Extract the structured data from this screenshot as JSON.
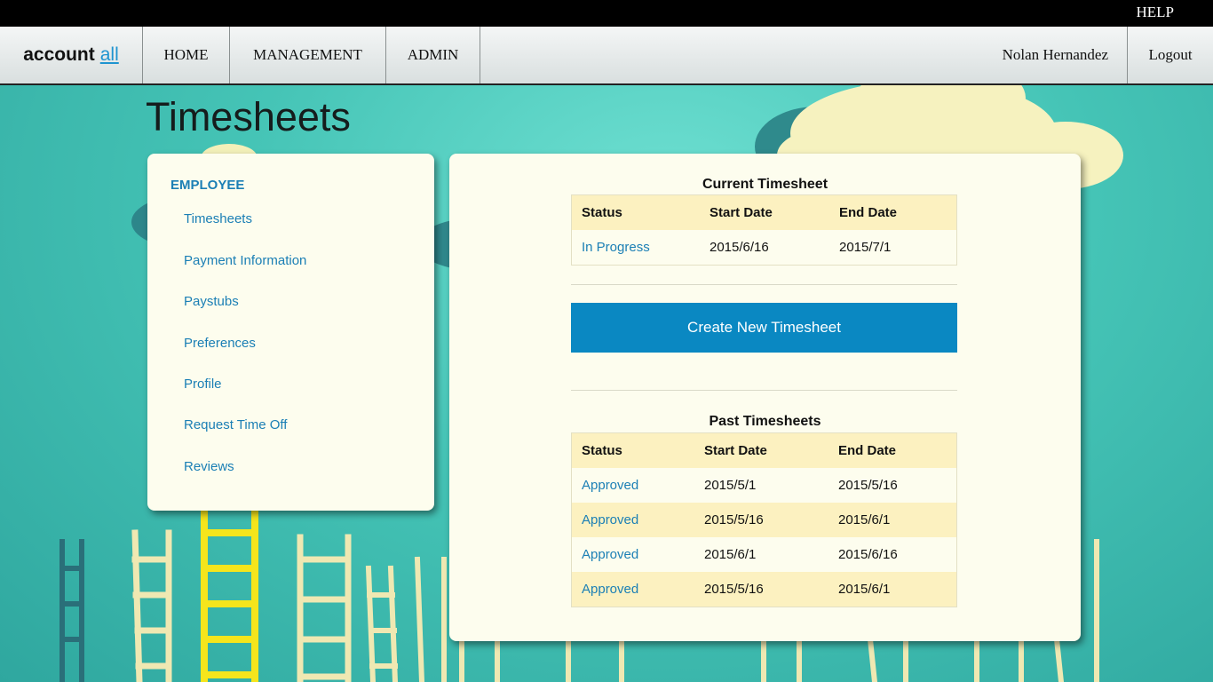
{
  "topbar": {
    "help_label": "HELP"
  },
  "nav": {
    "logo_main": "account",
    "logo_accent": "all",
    "items": [
      {
        "label": "HOME"
      },
      {
        "label": "MANAGEMENT"
      },
      {
        "label": "ADMIN"
      }
    ],
    "user_name": "Nolan Hernandez",
    "logout_label": "Logout"
  },
  "page": {
    "title": "Timesheets"
  },
  "sidebar": {
    "heading": "EMPLOYEE",
    "items": [
      {
        "label": "Timesheets"
      },
      {
        "label": "Payment Information"
      },
      {
        "label": "Paystubs"
      },
      {
        "label": "Preferences"
      },
      {
        "label": "Profile"
      },
      {
        "label": "Request Time Off"
      },
      {
        "label": "Reviews"
      }
    ]
  },
  "current": {
    "title": "Current Timesheet",
    "headers": {
      "status": "Status",
      "start": "Start Date",
      "end": "End Date"
    },
    "rows": [
      {
        "status": "In Progress",
        "start": "2015/6/16",
        "end": "2015/7/1"
      }
    ]
  },
  "create_button_label": "Create New Timesheet",
  "past": {
    "title": "Past Timesheets",
    "headers": {
      "status": "Status",
      "start": "Start Date",
      "end": "End Date"
    },
    "rows": [
      {
        "status": "Approved",
        "start": "2015/5/1",
        "end": "2015/5/16"
      },
      {
        "status": "Approved",
        "start": "2015/5/16",
        "end": "2015/6/1"
      },
      {
        "status": "Approved",
        "start": "2015/6/1",
        "end": "2015/6/16"
      },
      {
        "status": "Approved",
        "start": "2015/5/16",
        "end": "2015/6/1"
      }
    ]
  },
  "colors": {
    "accent": "#1b7fb5",
    "button": "#0a88c2",
    "panel": "#fdfdee",
    "row_alt": "#fcf1c0"
  }
}
